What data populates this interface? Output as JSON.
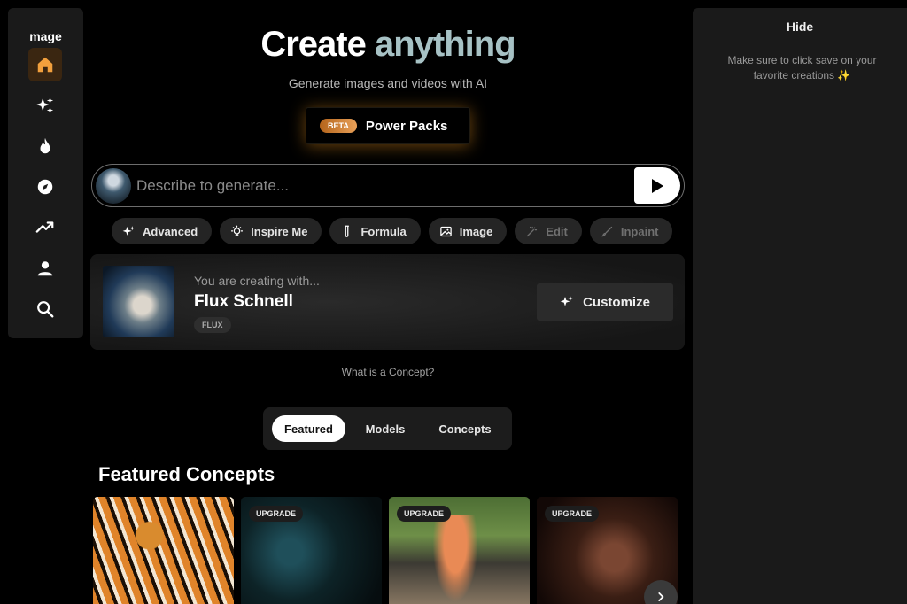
{
  "sidebar": {
    "logo": "mage",
    "items": [
      {
        "name": "home",
        "icon": "home-icon",
        "active": true
      },
      {
        "name": "create",
        "icon": "sparkles-icon"
      },
      {
        "name": "hot",
        "icon": "flame-icon"
      },
      {
        "name": "explore",
        "icon": "compass-icon"
      },
      {
        "name": "trending",
        "icon": "trending-up-icon"
      },
      {
        "name": "profile",
        "icon": "user-icon"
      },
      {
        "name": "search",
        "icon": "search-icon"
      }
    ]
  },
  "hero": {
    "title_part1": "Create",
    "title_part2": "anything",
    "subtitle": "Generate images and videos with AI"
  },
  "power_packs": {
    "badge": "BETA",
    "label": "Power Packs"
  },
  "prompt": {
    "placeholder": "Describe to generate..."
  },
  "chips": [
    {
      "label": "Advanced",
      "icon": "sparkles-icon",
      "enabled": true
    },
    {
      "label": "Inspire Me",
      "icon": "lightbulb-icon",
      "enabled": true
    },
    {
      "label": "Formula",
      "icon": "test-tube-icon",
      "enabled": true
    },
    {
      "label": "Image",
      "icon": "image-icon",
      "enabled": true
    },
    {
      "label": "Edit",
      "icon": "magic-wand-icon",
      "enabled": false
    },
    {
      "label": "Inpaint",
      "icon": "brush-icon",
      "enabled": false
    }
  ],
  "concept": {
    "pre": "You are creating with...",
    "name": "Flux Schnell",
    "tag": "FLUX",
    "customize_label": "Customize"
  },
  "what_is_concept": "What is a Concept?",
  "tabs": [
    {
      "label": "Featured",
      "active": true
    },
    {
      "label": "Models"
    },
    {
      "label": "Concepts"
    }
  ],
  "featured": {
    "title": "Featured Concepts",
    "cards": [
      {
        "badge": ""
      },
      {
        "badge": "UPGRADE"
      },
      {
        "badge": "UPGRADE"
      },
      {
        "badge": "UPGRADE"
      }
    ]
  },
  "right_panel": {
    "hide_label": "Hide",
    "hint": "Make sure to click save on your favorite creations ✨"
  }
}
